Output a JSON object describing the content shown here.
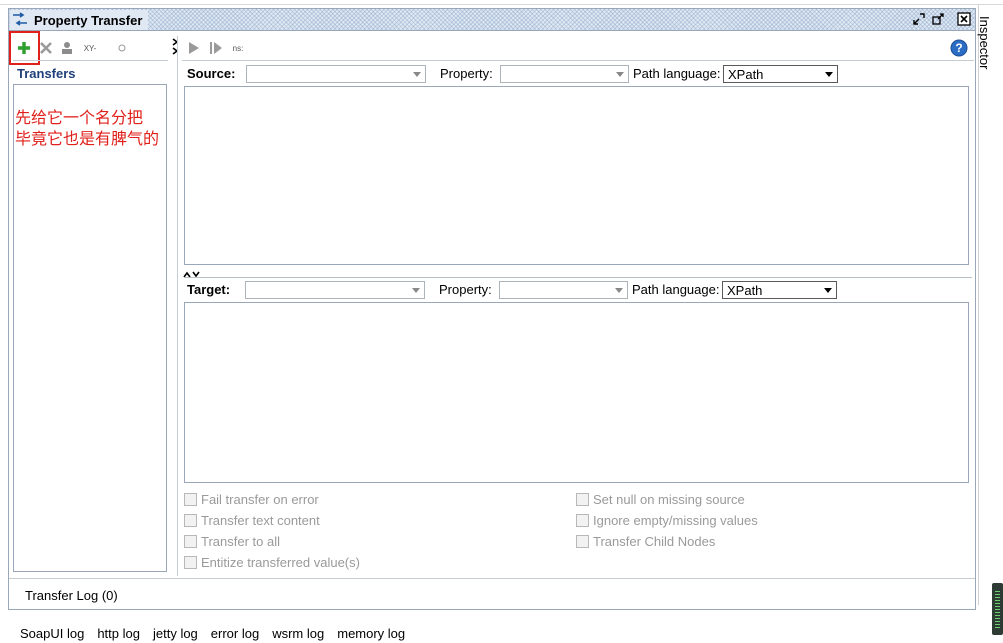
{
  "window": {
    "title": "Property Transfer"
  },
  "toolbar": {
    "xy_label": "XY-",
    "ns_label": "ns:",
    "add_icon": "plus-icon",
    "delete_icon": "x-icon"
  },
  "left": {
    "transfers_heading": "Transfers",
    "annotation_line1": "先给它一个名分把",
    "annotation_line2": "毕竟它也是有脾气的"
  },
  "source": {
    "label": "Source:",
    "property_label": "Property:",
    "path_language_label": "Path language:",
    "path_language_value": "XPath",
    "value": "",
    "property_value": ""
  },
  "target": {
    "label": "Target:",
    "property_label": "Property:",
    "path_language_label": "Path language:",
    "path_language_value": "XPath",
    "value": "",
    "property_value": ""
  },
  "options": {
    "left": [
      "Fail transfer on error",
      "Transfer text content",
      "Transfer to all",
      "Entitize transferred value(s)"
    ],
    "right": [
      "Set null on missing source",
      "Ignore empty/missing values",
      "Transfer Child Nodes"
    ]
  },
  "transfer_log": "Transfer Log (0)",
  "side_panel": {
    "inspector_label": "Inspector"
  },
  "log_tabs": [
    "SoapUI log",
    "http log",
    "jetty log",
    "error log",
    "wsrm log",
    "memory log"
  ],
  "colors": {
    "accent_red": "#e0201b",
    "add_green": "#2e9e2e",
    "help_blue": "#2b6cc4",
    "transfers_blue": "#1f3f7a"
  }
}
